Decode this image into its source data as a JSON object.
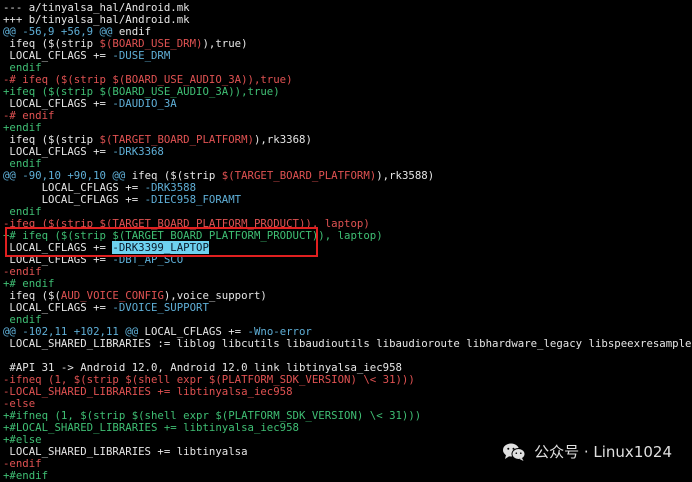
{
  "diff": {
    "lines": [
      [
        {
          "t": "--- a/tinyalsa_hal/Android.mk",
          "c": "meta"
        }
      ],
      [
        {
          "t": "+++ b/tinyalsa_hal/Android.mk",
          "c": "meta"
        }
      ],
      [
        {
          "t": "@@ -56,9 +56,9 @@",
          "c": "hunk"
        },
        {
          "t": " endif",
          "c": "plain"
        }
      ],
      [
        {
          "t": " ifeq ($(strip ",
          "c": "plain"
        },
        {
          "t": "$(BOARD_USE_DRM)",
          "c": "var"
        },
        {
          "t": "),true)",
          "c": "plain"
        }
      ],
      [
        {
          "t": " LOCAL_CFLAGS += ",
          "c": "plain"
        },
        {
          "t": "-DUSE_DRM",
          "c": "flag"
        }
      ],
      [
        {
          "t": " endif",
          "c": "add"
        }
      ],
      [
        {
          "t": "-# ifeq ($(strip $(BOARD_USE_AUDIO_3A)),true)",
          "c": "del"
        }
      ],
      [
        {
          "t": "+ifeq ($(strip $(BOARD_USE_AUDIO_3A)),true)",
          "c": "add"
        }
      ],
      [
        {
          "t": " LOCAL_CFLAGS += ",
          "c": "plain"
        },
        {
          "t": "-DAUDIO_3A",
          "c": "flag"
        }
      ],
      [
        {
          "t": "-# endif",
          "c": "del"
        }
      ],
      [
        {
          "t": "+endif",
          "c": "add"
        }
      ],
      [
        {
          "t": " ifeq ($(strip ",
          "c": "plain"
        },
        {
          "t": "$(TARGET_BOARD_PLATFORM)",
          "c": "var"
        },
        {
          "t": "),rk3368)",
          "c": "plain"
        }
      ],
      [
        {
          "t": " LOCAL_CFLAGS += ",
          "c": "plain"
        },
        {
          "t": "-DRK3368",
          "c": "flag"
        }
      ],
      [
        {
          "t": " endif",
          "c": "add"
        }
      ],
      [
        {
          "t": "@@ -90,10 +90,10 @@",
          "c": "hunk"
        },
        {
          "t": " ifeq ($(strip ",
          "c": "plain"
        },
        {
          "t": "$(TARGET_BOARD_PLATFORM)",
          "c": "var"
        },
        {
          "t": "),rk3588)",
          "c": "plain"
        }
      ],
      [
        {
          "t": "      LOCAL_CFLAGS += ",
          "c": "plain"
        },
        {
          "t": "-DRK3588",
          "c": "flag"
        }
      ],
      [
        {
          "t": "      LOCAL_CFLAGS += ",
          "c": "plain"
        },
        {
          "t": "-DIEC958_FORAMT",
          "c": "flag"
        }
      ],
      [
        {
          "t": " endif",
          "c": "add"
        }
      ],
      [
        {
          "t": "-ifeq ($(strip $(TARGET_BOARD_PLATFORM_PRODUCT)), laptop)",
          "c": "del"
        }
      ],
      [
        {
          "t": "+# ifeq ($(strip $(TARGET_BOARD_PLATFORM_PRODUCT)), laptop)",
          "c": "add"
        }
      ],
      [
        {
          "t": " LOCAL_CFLAGS += ",
          "c": "plain"
        },
        {
          "t": "-DRK3399_LAPTOP",
          "c": "sel"
        }
      ],
      [
        {
          "t": " LOCAL_CFLAGS += ",
          "c": "plain"
        },
        {
          "t": "-DBT_AP_SCO",
          "c": "flag"
        }
      ],
      [
        {
          "t": "-endif",
          "c": "del"
        }
      ],
      [
        {
          "t": "+# endif",
          "c": "add"
        }
      ],
      [
        {
          "t": " ifeq ($(",
          "c": "plain"
        },
        {
          "t": "AUD_VOICE_CONFIG",
          "c": "var"
        },
        {
          "t": "),voice_support)",
          "c": "plain"
        }
      ],
      [
        {
          "t": " LOCAL_CFLAGS += ",
          "c": "plain"
        },
        {
          "t": "-DVOICE_SUPPORT",
          "c": "flag"
        }
      ],
      [
        {
          "t": " endif",
          "c": "add"
        }
      ],
      [
        {
          "t": "@@ -102,11 +102,11 @@",
          "c": "hunk"
        },
        {
          "t": " LOCAL_CFLAGS += ",
          "c": "plain"
        },
        {
          "t": "-Wno-error",
          "c": "flag"
        }
      ],
      [
        {
          "t": " LOCAL_SHARED_LIBRARIES := liblog libcutils libaudioutils libaudioroute libhardware_legacy libspeexresampler",
          "c": "plain"
        }
      ],
      [
        {
          "t": "",
          "c": "plain"
        }
      ],
      [
        {
          "t": " #API 31 -> Android 12.0, Android 12.0 link libtinyalsa_iec958",
          "c": "plain"
        }
      ],
      [
        {
          "t": "-ifneq (1, $(strip $(shell expr $(PLATFORM_SDK_VERSION) \\< 31)))",
          "c": "del"
        }
      ],
      [
        {
          "t": "-LOCAL_SHARED_LIBRARIES += libtinyalsa_iec958",
          "c": "del"
        }
      ],
      [
        {
          "t": "-else",
          "c": "del"
        }
      ],
      [
        {
          "t": "+#ifneq (1, $(strip $(shell expr $(PLATFORM_SDK_VERSION) \\< 31)))",
          "c": "add"
        }
      ],
      [
        {
          "t": "+#LOCAL_SHARED_LIBRARIES += libtinyalsa_iec958",
          "c": "add"
        }
      ],
      [
        {
          "t": "+#else",
          "c": "add"
        }
      ],
      [
        {
          "t": " LOCAL_SHARED_LIBRARIES += libtinyalsa",
          "c": "plain"
        }
      ],
      [
        {
          "t": "-endif",
          "c": "del"
        }
      ],
      [
        {
          "t": "+#endif",
          "c": "add"
        }
      ]
    ]
  },
  "highlight": {
    "color": "#e02020"
  },
  "watermark": {
    "icon": "wechat-icon",
    "text": "公众号 · Linux1024"
  },
  "colors": {
    "background": "#000000",
    "plain": "#e6e6e6",
    "hunk": "#5fafd7",
    "del": "#e05252",
    "add": "#3fbf74",
    "selection": "#6ed2f0"
  }
}
